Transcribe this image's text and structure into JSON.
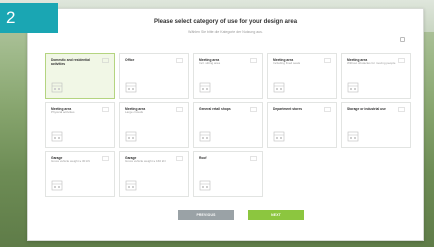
{
  "step": {
    "number": "2",
    "color": "#1aa6b3"
  },
  "dialog": {
    "title": "Please select category of use for your design area",
    "subtitle": "Wählen Sie bitte die Kategorie der Nutzung aus.",
    "close_icon": "close-icon"
  },
  "categories": [
    {
      "label": "Domestic and residential activities",
      "sub": "",
      "selected": true
    },
    {
      "label": "Office",
      "sub": "",
      "selected": false
    },
    {
      "label": "Meeting area",
      "sub": "Incl. sitting area",
      "selected": false
    },
    {
      "label": "Meeting area",
      "sub": "Including fixed seats",
      "selected": false
    },
    {
      "label": "Meeting area",
      "sub": "Without obstacles for moving people",
      "selected": false
    },
    {
      "label": "Meeting area",
      "sub": "Physical activities",
      "selected": false
    },
    {
      "label": "Meeting area",
      "sub": "Large crowds",
      "selected": false
    },
    {
      "label": "General retail shops",
      "sub": "",
      "selected": false
    },
    {
      "label": "Department stores",
      "sub": "",
      "selected": false
    },
    {
      "label": "Storage or industrial use",
      "sub": "",
      "selected": false
    },
    {
      "label": "Garage",
      "sub": "Gross vehicle weight ≤ 30 kN",
      "selected": false
    },
    {
      "label": "Garage",
      "sub": "Gross vehicle weight ≤ 160 kN",
      "selected": false
    },
    {
      "label": "Roof",
      "sub": "",
      "selected": false
    }
  ],
  "buttons": {
    "previous": "PREVIOUS",
    "next": "NEXT"
  },
  "colors": {
    "selected_bg": "#f1f7e6",
    "selected_border": "#b4d480",
    "next_button": "#8cc63f",
    "previous_button": "#9aa2a6"
  }
}
